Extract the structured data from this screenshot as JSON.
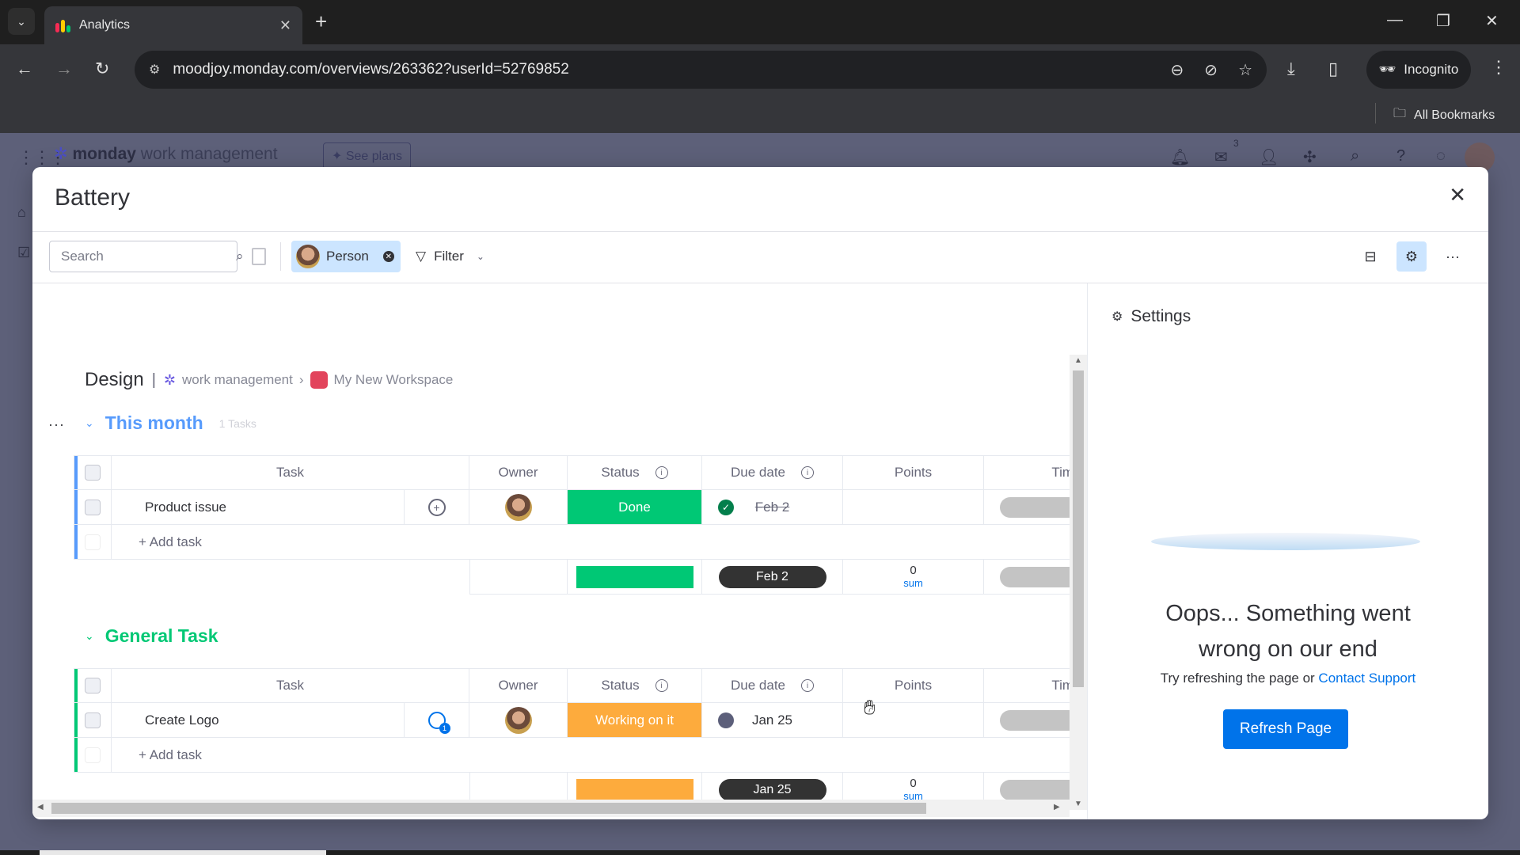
{
  "browser": {
    "tab_title": "Analytics",
    "url": "moodjoy.monday.com/overviews/263362?userId=52769852",
    "incognito_label": "Incognito",
    "bookmarks_label": "All Bookmarks",
    "icons": {
      "tab_list": "chevron-down-icon",
      "new_tab": "plus-icon",
      "zoom": "zoom-out-icon",
      "eye_off": "eye-off-icon",
      "star": "star-icon",
      "download": "download-icon",
      "sidepanel": "side-panel-icon",
      "menu": "kebab-icon"
    }
  },
  "app_header": {
    "brand_bold": "monday",
    "brand_light": " work management",
    "see_plans_label": "See plans",
    "inbox_badge": "3"
  },
  "modal": {
    "title": "Battery",
    "toolbar": {
      "search_placeholder": "Search",
      "person_label": "Person",
      "filter_label": "Filter"
    },
    "board": {
      "name": "Design",
      "breadcrumb": [
        "work management",
        "My New Workspace"
      ],
      "columns": [
        "Task",
        "Owner",
        "Status",
        "Due date",
        "Points",
        "Timeline"
      ],
      "add_task_label": "+ Add task",
      "groups": [
        {
          "name": "This month",
          "count_label": "1 Tasks",
          "color": "#579bfc",
          "rows": [
            {
              "task": "Product issue",
              "status": "Done",
              "status_color": "#00c875",
              "due_date": "Feb 2",
              "due_done": true,
              "points": "",
              "timeline": "-",
              "updates": 0
            }
          ],
          "summary": {
            "status_color": "#00c875",
            "due_date": "Feb 2",
            "points_value": "0",
            "points_label": "sum",
            "timeline": "-"
          }
        },
        {
          "name": "General Task",
          "count_label": "",
          "color": "#00c875",
          "rows": [
            {
              "task": "Create Logo",
              "status": "Working on it",
              "status_color": "#fdab3d",
              "due_date": "Jan 25",
              "due_done": false,
              "points": "",
              "timeline": "-",
              "updates": 1
            }
          ],
          "summary": {
            "status_color": "#fdab3d",
            "due_date": "Jan 25",
            "points_value": "0",
            "points_label": "sum",
            "timeline": "-"
          }
        }
      ]
    },
    "settings": {
      "title": "Settings",
      "error_title": "Oops... Something went wrong on our end",
      "error_sub_prefix": "Try refreshing the page or ",
      "contact_link": "Contact Support",
      "refresh_label": "Refresh Page"
    }
  }
}
